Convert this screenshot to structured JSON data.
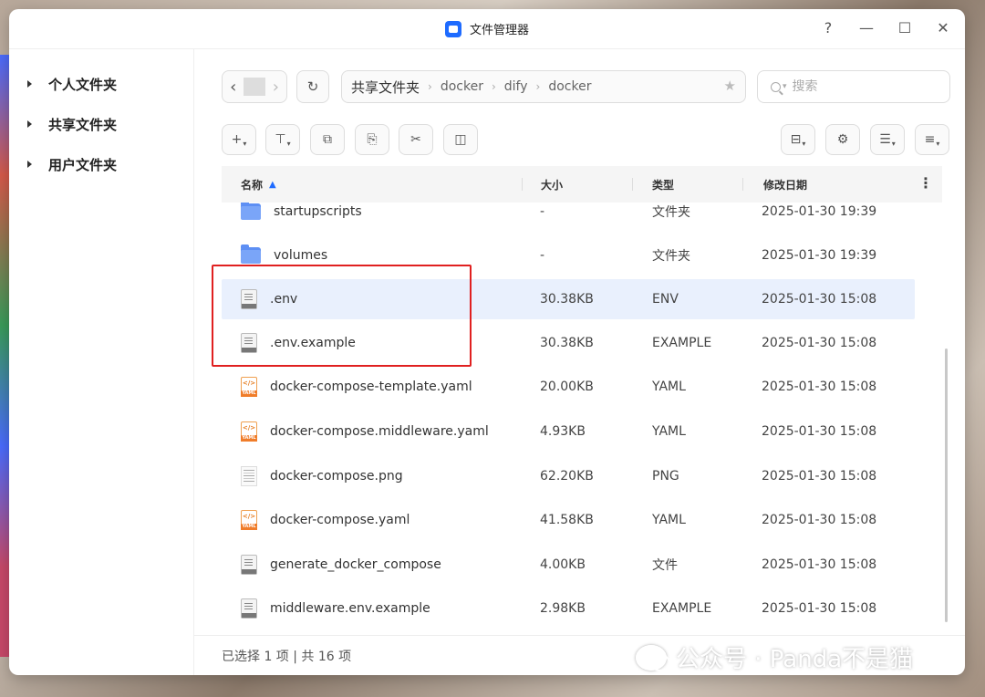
{
  "window": {
    "title": "文件管理器",
    "controls": [
      "?",
      "—",
      "☐",
      "✕"
    ]
  },
  "sidebar": {
    "items": [
      {
        "label": "个人文件夹"
      },
      {
        "label": "共享文件夹"
      },
      {
        "label": "用户文件夹"
      }
    ]
  },
  "nav": {
    "back": "‹",
    "forward": "›",
    "refresh": "↻"
  },
  "breadcrumb": [
    "共享文件夹",
    "docker",
    "dify",
    "docker"
  ],
  "search": {
    "placeholder": "搜索"
  },
  "toolbar": {
    "icons": [
      "plus-icon",
      "upload-icon",
      "copy-icon",
      "paste-icon",
      "cut-icon",
      "duplicate-icon",
      "briefcase-icon",
      "gear-icon",
      "list-view-icon",
      "sort-icon"
    ]
  },
  "table": {
    "columns": [
      "名称",
      "大小",
      "类型",
      "修改日期"
    ],
    "rows": [
      {
        "name": "startupscripts",
        "size": "-",
        "type": "文件夹",
        "date": "2025-01-30 19:39",
        "icon": "folder"
      },
      {
        "name": "volumes",
        "size": "-",
        "type": "文件夹",
        "date": "2025-01-30 19:39",
        "icon": "folder"
      },
      {
        "name": ".env",
        "size": "30.38KB",
        "type": "ENV",
        "date": "2025-01-30 15:08",
        "icon": "doc",
        "selected": true
      },
      {
        "name": ".env.example",
        "size": "30.38KB",
        "type": "EXAMPLE",
        "date": "2025-01-30 15:08",
        "icon": "doc"
      },
      {
        "name": "docker-compose-template.yaml",
        "size": "20.00KB",
        "type": "YAML",
        "date": "2025-01-30 15:08",
        "icon": "yaml"
      },
      {
        "name": "docker-compose.middleware.yaml",
        "size": "4.93KB",
        "type": "YAML",
        "date": "2025-01-30 15:08",
        "icon": "yaml"
      },
      {
        "name": "docker-compose.png",
        "size": "62.20KB",
        "type": "PNG",
        "date": "2025-01-30 15:08",
        "icon": "png"
      },
      {
        "name": "docker-compose.yaml",
        "size": "41.58KB",
        "type": "YAML",
        "date": "2025-01-30 15:08",
        "icon": "yaml"
      },
      {
        "name": "generate_docker_compose",
        "size": "4.00KB",
        "type": "文件",
        "date": "2025-01-30 15:08",
        "icon": "doc"
      },
      {
        "name": "middleware.env.example",
        "size": "2.98KB",
        "type": "EXAMPLE",
        "date": "2025-01-30 15:08",
        "icon": "doc"
      }
    ]
  },
  "status": {
    "text": "已选择 1 项 | 共 16 项"
  },
  "watermark": {
    "text": "公众号 · Panda不是猫"
  },
  "colors": {
    "accent": "#1e6bff",
    "selected_row": "#e9f0fd",
    "highlight_box": "#e02020",
    "folder": "#5d8ff4"
  }
}
